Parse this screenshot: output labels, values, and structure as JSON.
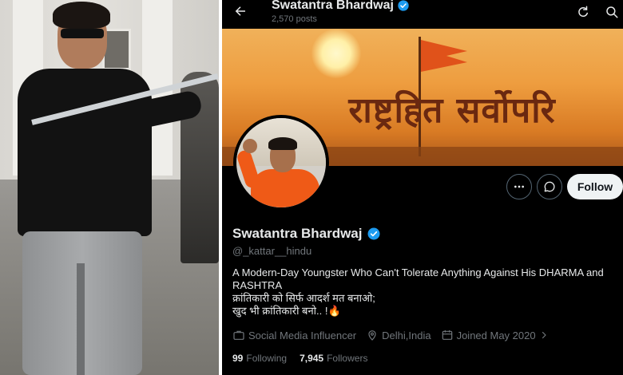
{
  "profile": {
    "display_name": "Swatantra Bhardwaj",
    "posts_count": "2,570 posts",
    "handle": "@_kattar__hindu",
    "bio_lines": [
      "A Modern-Day Youngster Who Can't Tolerate Anything Against His DHARMA and",
      "RASHTRA",
      "क्रांतिकारी को सिर्फ आदर्श मत बनाओ;",
      "खुद भी क्रांतिकारी बनो.. !🔥"
    ],
    "category": "Social Media Influencer",
    "location": "Delhi,India",
    "joined": "Joined May 2020",
    "following_count": "99",
    "following_label": "Following",
    "followers_count": "7,945",
    "followers_label": "Followers",
    "verified": true
  },
  "banner": {
    "text": "राष्ट्रहित सर्वोपरि"
  },
  "actions": {
    "follow_label": "Follow"
  },
  "icons": {
    "back": "arrow-left-icon",
    "refresh": "refresh-icon",
    "search": "search-icon",
    "more": "more-icon",
    "message": "message-icon",
    "verified": "verified-badge-icon",
    "category": "briefcase-icon",
    "location": "location-pin-icon",
    "joined": "calendar-icon"
  },
  "colors": {
    "background": "#000000",
    "text_primary": "#e7e9ea",
    "text_secondary": "#71767b",
    "verified_blue": "#1d9bf0",
    "follow_button_bg": "#eff3f4"
  }
}
